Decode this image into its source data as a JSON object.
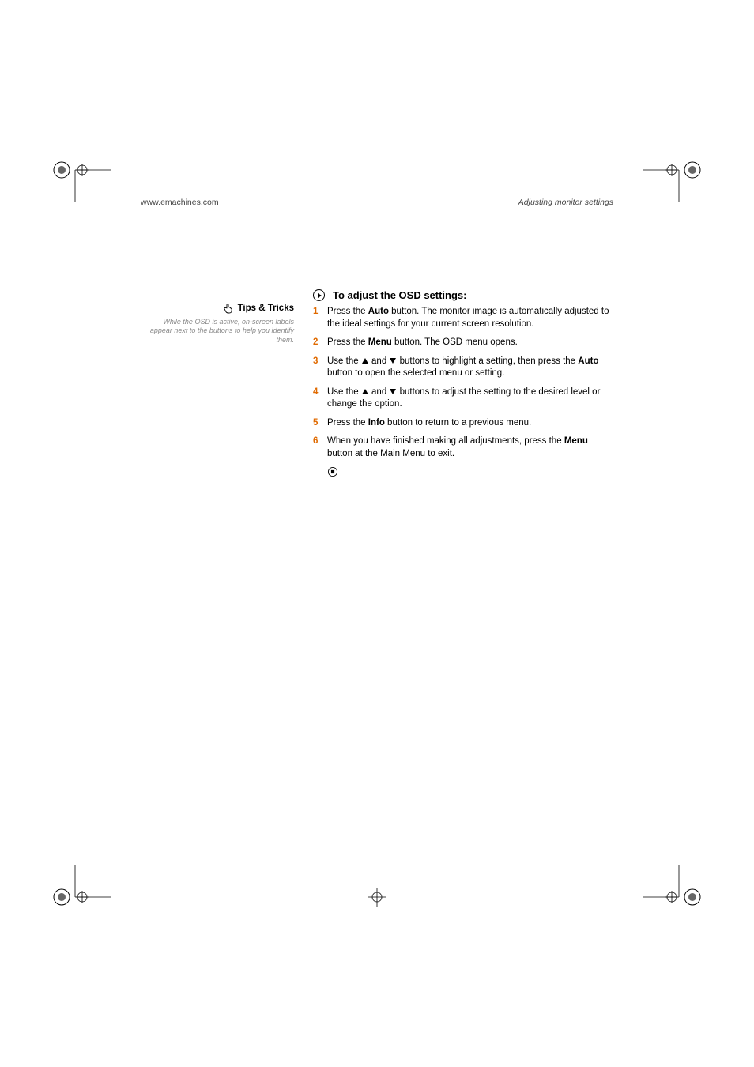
{
  "header": {
    "left": "www.emachines.com",
    "right": "Adjusting monitor settings"
  },
  "sidebar": {
    "tips_label": "Tips & Tricks",
    "tips_text": "While the OSD is active, on-screen labels appear next to the buttons to help you identify them."
  },
  "procedure": {
    "title": "To adjust the OSD settings:",
    "steps": {
      "s1a": "Press the ",
      "s1b": "Auto",
      "s1c": " button. The monitor image is automatically adjusted to the ideal settings for your current screen resolution.",
      "s2a": "Press the ",
      "s2b": "Menu",
      "s2c": " button. The OSD menu opens.",
      "s3a": "Use the ",
      "s3b": " and ",
      "s3c": " buttons to highlight a setting, then press the ",
      "s3d": "Auto",
      "s3e": " button to open the selected menu or setting.",
      "s4a": "Use the ",
      "s4b": " and ",
      "s4c": " buttons to adjust the setting to the desired level or change the option.",
      "s5a": "Press the ",
      "s5b": "Info",
      "s5c": " button to return to a previous menu.",
      "s6a": "When you have finished making all adjustments, press the ",
      "s6b": "Menu",
      "s6c": " button at the Main Menu to exit."
    }
  }
}
